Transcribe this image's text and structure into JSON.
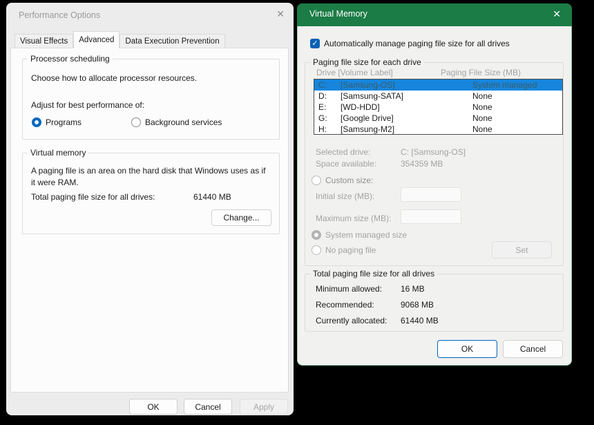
{
  "colors": {
    "vm_titlebar_green": "#1b7c46",
    "accent_blue": "#0067c0",
    "selection_blue": "#1685dc"
  },
  "perf_dialog": {
    "title": "Performance Options",
    "close_icon": "✕",
    "tabs": [
      {
        "label": "Visual Effects",
        "selected": false
      },
      {
        "label": "Advanced",
        "selected": true
      },
      {
        "label": "Data Execution Prevention",
        "selected": false
      }
    ],
    "processor_group": {
      "title": "Processor scheduling",
      "description": "Choose how to allocate processor resources.",
      "adjust_label": "Adjust for best performance of:",
      "options": [
        {
          "label": "Programs",
          "selected": true
        },
        {
          "label": "Background services",
          "selected": false
        }
      ]
    },
    "virtual_memory_group": {
      "title": "Virtual memory",
      "description": "A paging file is an area on the hard disk that Windows uses as if it were RAM.",
      "total_label": "Total paging file size for all drives:",
      "total_value": "61440 MB",
      "change_button": "Change..."
    },
    "footer": {
      "ok_button": "OK",
      "cancel_button": "Cancel",
      "apply_button": "Apply"
    }
  },
  "vm_dialog": {
    "title": "Virtual Memory",
    "close_icon": "✕",
    "auto_manage_checkbox": {
      "label": "Automatically manage paging file size for all drives",
      "checked": true
    },
    "paging_group": {
      "title": "Paging file size for each drive",
      "columns": {
        "drive": "Drive  [Volume Label]",
        "size": "Paging File Size (MB)"
      },
      "rows": [
        {
          "drive": "C:",
          "volume": "[Samsung-OS]",
          "size": "System managed",
          "selected": true
        },
        {
          "drive": "D:",
          "volume": "[Samsung-SATA]",
          "size": "None",
          "selected": false
        },
        {
          "drive": "E:",
          "volume": "[WD-HDD]",
          "size": "None",
          "selected": false
        },
        {
          "drive": "G:",
          "volume": "[Google Drive]",
          "size": "None",
          "selected": false
        },
        {
          "drive": "H:",
          "volume": "[Samsung-M2]",
          "size": "None",
          "selected": false
        }
      ],
      "selected_drive_label": "Selected drive:",
      "selected_drive_value": "C:  [Samsung-OS]",
      "space_available_label": "Space available:",
      "space_available_value": "354359 MB",
      "custom_size_label": "Custom size:",
      "initial_size_label": "Initial size (MB):",
      "maximum_size_label": "Maximum size (MB):",
      "system_managed_label": "System managed size",
      "no_paging_label": "No paging file",
      "set_button": "Set"
    },
    "total_group": {
      "title": "Total paging file size for all drives",
      "rows": [
        {
          "label": "Minimum allowed:",
          "value": "16 MB"
        },
        {
          "label": "Recommended:",
          "value": "9068 MB"
        },
        {
          "label": "Currently allocated:",
          "value": "61440 MB"
        }
      ]
    },
    "footer": {
      "ok_button": "OK",
      "cancel_button": "Cancel"
    }
  }
}
